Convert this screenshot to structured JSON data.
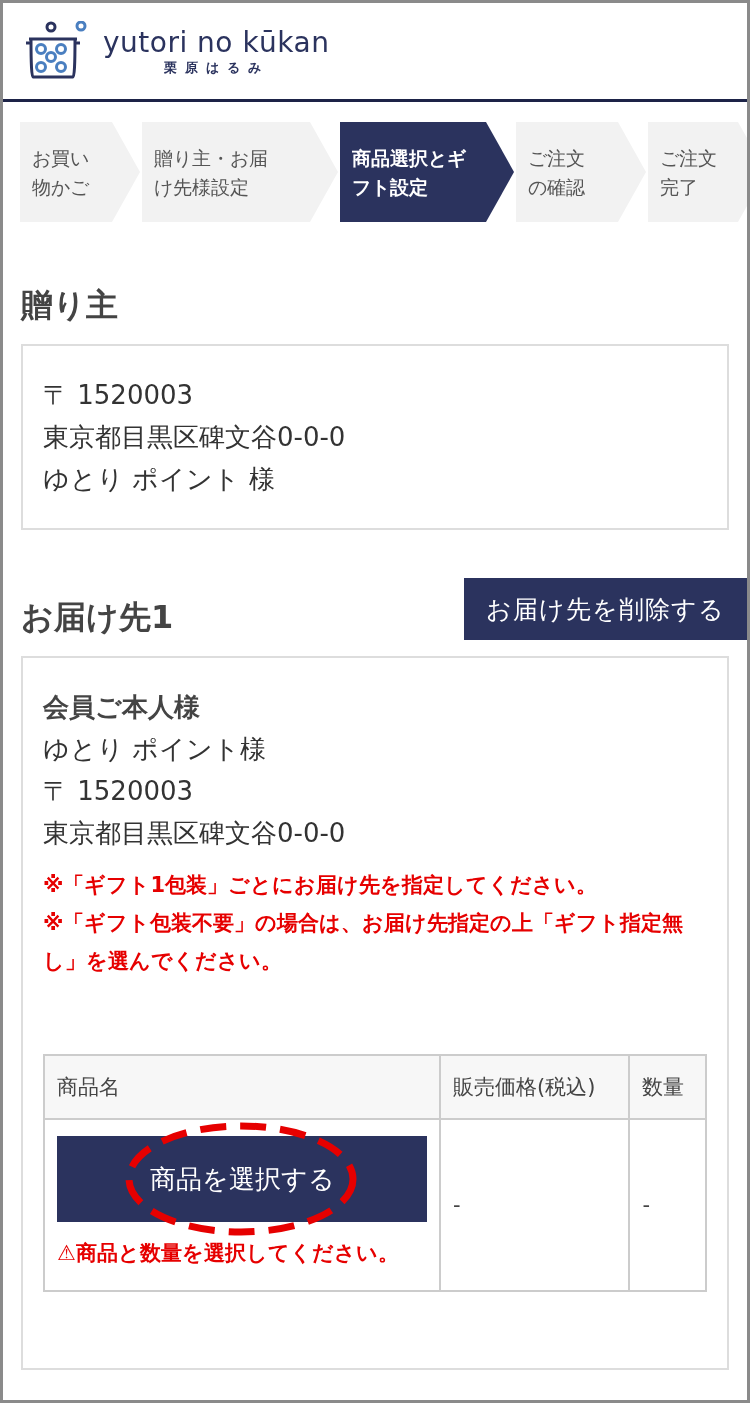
{
  "header": {
    "logo_title": "yutori no kūkan",
    "logo_subtitle": "栗原はるみ"
  },
  "steps": [
    {
      "lines": [
        "お買い",
        "物かご"
      ],
      "selected": false
    },
    {
      "lines": [
        "贈り主・お届",
        "け先様設定"
      ],
      "selected": false
    },
    {
      "lines": [
        "商品選択とギ",
        "フト設定"
      ],
      "selected": true
    },
    {
      "lines": [
        "ご注文",
        "の確認"
      ],
      "selected": false
    },
    {
      "lines": [
        "ご注文",
        "完了"
      ],
      "selected": false
    }
  ],
  "sender": {
    "heading": "贈り主",
    "lines": [
      "〒 1520003",
      "東京都目黒区碑文谷0-0-0",
      "ゆとり ポイント 様"
    ]
  },
  "destination": {
    "heading": "お届け先1",
    "delete_button": "お届け先を削除する",
    "member_label": "会員ご本人様",
    "lines": [
      "ゆとり ポイント様",
      "〒 1520003",
      "東京都目黒区碑文谷0-0-0"
    ],
    "notes": [
      "※「ギフト1包装」ごとにお届け先を指定してください。",
      "※「ギフト包装不要」の場合は、お届け先指定の上「ギフト指定無し」を選んでください。"
    ],
    "table": {
      "columns": [
        "商品名",
        "販売価格(税込)",
        "数量"
      ],
      "row": {
        "select_button": "商品を選択する",
        "warning": "⚠商品と数量を選択してください。",
        "price": "-",
        "quantity": "-"
      }
    }
  }
}
